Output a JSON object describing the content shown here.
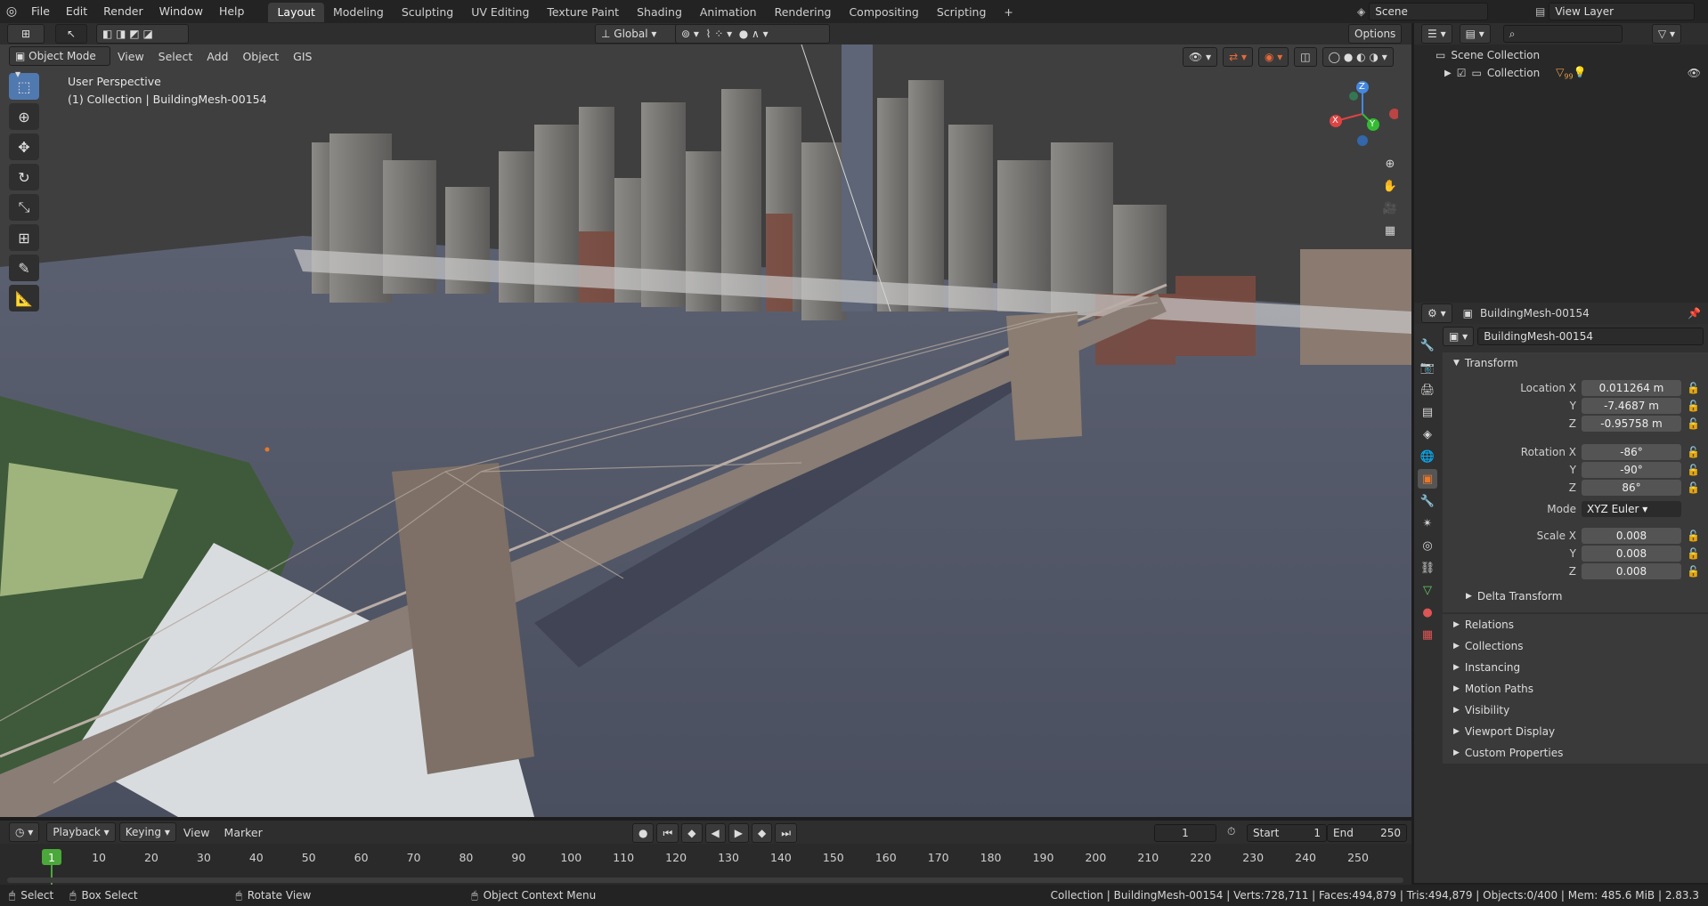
{
  "topbar": {
    "menus": [
      "File",
      "Edit",
      "Render",
      "Window",
      "Help"
    ],
    "workspaces": [
      "Layout",
      "Modeling",
      "Sculpting",
      "UV Editing",
      "Texture Paint",
      "Shading",
      "Animation",
      "Rendering",
      "Compositing",
      "Scripting"
    ],
    "active_workspace": "Layout",
    "add_tab": "+",
    "scene": "Scene",
    "view_layer": "View Layer"
  },
  "viewport_header": {
    "mode": "Object Mode",
    "menus": [
      "View",
      "Select",
      "Add",
      "Object",
      "GIS"
    ],
    "orientation": "Global",
    "options": "Options"
  },
  "viewport": {
    "perspective": "User Perspective",
    "collection_info": "(1) Collection | BuildingMesh-00154",
    "gizmo": {
      "x": "X",
      "y": "Y",
      "z": "Z"
    }
  },
  "outliner": {
    "scene_collection": "Scene Collection",
    "collection": "Collection",
    "badge": "99"
  },
  "properties": {
    "object_name": "BuildingMesh-00154",
    "data_name": "BuildingMesh-00154",
    "transform_label": "Transform",
    "location": {
      "label": "Location X",
      "x": "0.011264 m",
      "y": "-7.4687 m",
      "z": "-0.95758 m"
    },
    "rotation": {
      "label": "Rotation X",
      "x": "-86°",
      "y": "-90°",
      "z": "86°"
    },
    "mode_label": "Mode",
    "mode_value": "XYZ Euler",
    "scale": {
      "label": "Scale X",
      "x": "0.008",
      "y": "0.008",
      "z": "0.008"
    },
    "axis_y": "Y",
    "axis_z": "Z",
    "delta_transform": "Delta Transform",
    "sections": [
      "Relations",
      "Collections",
      "Instancing",
      "Motion Paths",
      "Visibility",
      "Viewport Display",
      "Custom Properties"
    ]
  },
  "timeline": {
    "menus": [
      "Playback",
      "Keying",
      "View",
      "Marker"
    ],
    "current_frame": "1",
    "start_label": "Start",
    "start_value": "1",
    "end_label": "End",
    "end_value": "250",
    "ticks": [
      "1",
      "10",
      "20",
      "30",
      "40",
      "50",
      "60",
      "70",
      "80",
      "90",
      "100",
      "110",
      "120",
      "130",
      "140",
      "150",
      "160",
      "170",
      "180",
      "190",
      "200",
      "210",
      "220",
      "230",
      "240",
      "250"
    ]
  },
  "statusbar": {
    "select": "Select",
    "box_select": "Box Select",
    "rotate_view": "Rotate View",
    "context_menu": "Object Context Menu",
    "stats": "Collection | BuildingMesh-00154 | Verts:728,711 | Faces:494,879 | Tris:494,879 | Objects:0/400 | Mem: 485.6 MiB | 2.83.3"
  },
  "colors": {
    "accent": "#5079b0",
    "active_frame": "#4ba83a",
    "object_orange": "#e8782a"
  }
}
